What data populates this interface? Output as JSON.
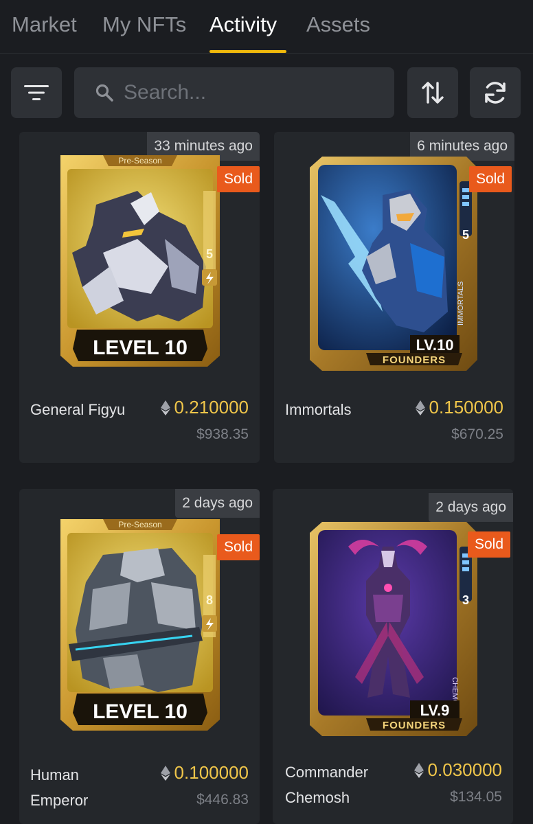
{
  "tabs": [
    {
      "label": "Market"
    },
    {
      "label": "My NFTs"
    },
    {
      "label": "Activity"
    },
    {
      "label": "Assets"
    }
  ],
  "active_tab": "Activity",
  "search": {
    "placeholder": "Search..."
  },
  "icons": {
    "filter": "filter-icon",
    "search": "search-icon",
    "sort": "sort-icon",
    "refresh": "refresh-icon",
    "currency": "ethereum-icon"
  },
  "colors": {
    "accent": "#f0b90b",
    "sold": "#e95a1c",
    "price": "#f0c64a"
  },
  "items": [
    {
      "time": "33 minutes ago",
      "status": "Sold",
      "badge_label": "Pre-Season",
      "level_banner": "LEVEL 10",
      "side_number": "5",
      "name_lines": [
        "General Figyu"
      ],
      "price": "0.210000",
      "usd": "$938.35"
    },
    {
      "time": "6 minutes ago",
      "status": "Sold",
      "level_banner": "LV.10",
      "footer_label": "FOUNDERS",
      "side_number": "5",
      "side_label": "IMMORTALS",
      "name_lines": [
        "Immortals"
      ],
      "price": "0.150000",
      "usd": "$670.25"
    },
    {
      "time": "2 days ago",
      "status": "Sold",
      "badge_label": "Pre-Season",
      "level_banner": "LEVEL 10",
      "side_number": "8",
      "name_lines": [
        "Human",
        "Emperor"
      ],
      "price": "0.100000",
      "usd": "$446.83"
    },
    {
      "time": "2 days ago",
      "status": "Sold",
      "level_banner": "LV.9",
      "footer_label": "FOUNDERS",
      "side_number": "3",
      "side_label": "CHEMOSH",
      "name_lines": [
        "Commander",
        "Chemosh"
      ],
      "price": "0.030000",
      "usd": "$134.05"
    }
  ]
}
